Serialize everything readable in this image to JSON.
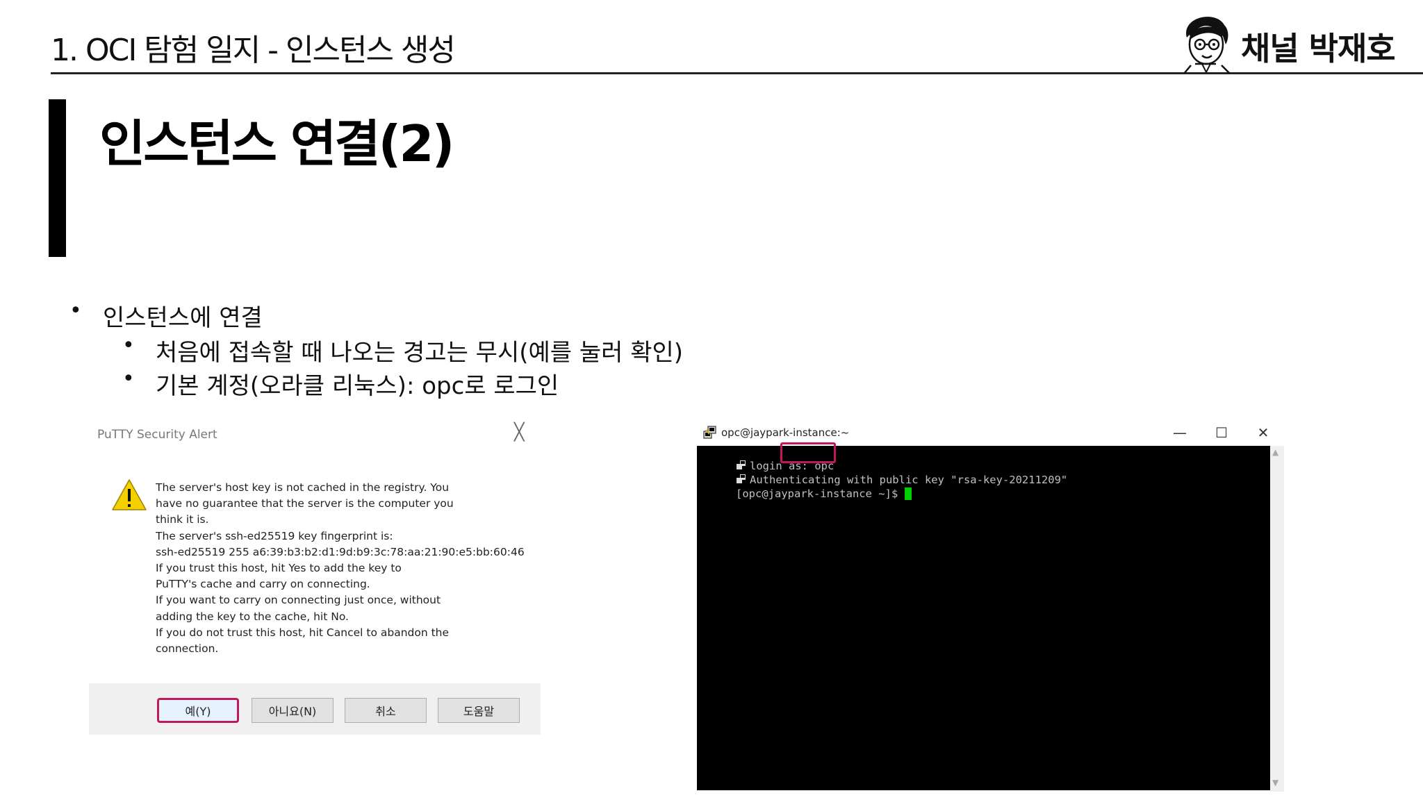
{
  "header": {
    "title": "1. OCI 탐험 일지 - 인스턴스 생성",
    "logo_text": "채널 박재호"
  },
  "slide": {
    "title": "인스턴스 연결(2)",
    "bullets": [
      {
        "text": "인스턴스에 연결",
        "level": 1
      },
      {
        "text": "처음에 접속할 때 나오는 경고는 무시(예를 눌러 확인)",
        "level": 2
      },
      {
        "text": "기본 계정(오라클 리눅스): opc로 로그인",
        "level": 2
      }
    ],
    "bullet_glyph": "•"
  },
  "alert": {
    "title": "PuTTY Security Alert",
    "close_glyph": "╳",
    "warning_icon": "warning-icon",
    "message_lines": [
      "The server's host key is not cached in the registry. You",
      "have no guarantee that the server is the computer you",
      "think it is.",
      "The server's ssh-ed25519 key fingerprint is:",
      "ssh-ed25519 255 a6:39:b3:b2:d1:9d:b9:3c:78:aa:21:90:e5:bb:60:46",
      "If you trust this host, hit Yes to add the key to",
      "PuTTY's cache and carry on connecting.",
      "If you want to carry on connecting just once, without",
      "adding the key to the cache, hit No.",
      "If you do not trust this host, hit Cancel to abandon the",
      "connection."
    ],
    "buttons": {
      "yes": "예(Y)",
      "no": "아니요(N)",
      "cancel": "취소",
      "help": "도움말"
    },
    "highlight_color": "#c0185a"
  },
  "terminal": {
    "title": "opc@jaypark-instance:~",
    "window_buttons": {
      "minimize": "—",
      "maximize": "☐",
      "close": "✕"
    },
    "lines": [
      {
        "prefix_icon": true,
        "text": "login as: opc"
      },
      {
        "prefix_icon": true,
        "text": "Authenticating with public key \"rsa-key-20211209\""
      },
      {
        "prefix_icon": false,
        "text": "[opc@jaypark-instance ~]$ "
      }
    ],
    "cursor_color": "#00d000",
    "scroll_up": "▲",
    "scroll_down": "▼"
  }
}
